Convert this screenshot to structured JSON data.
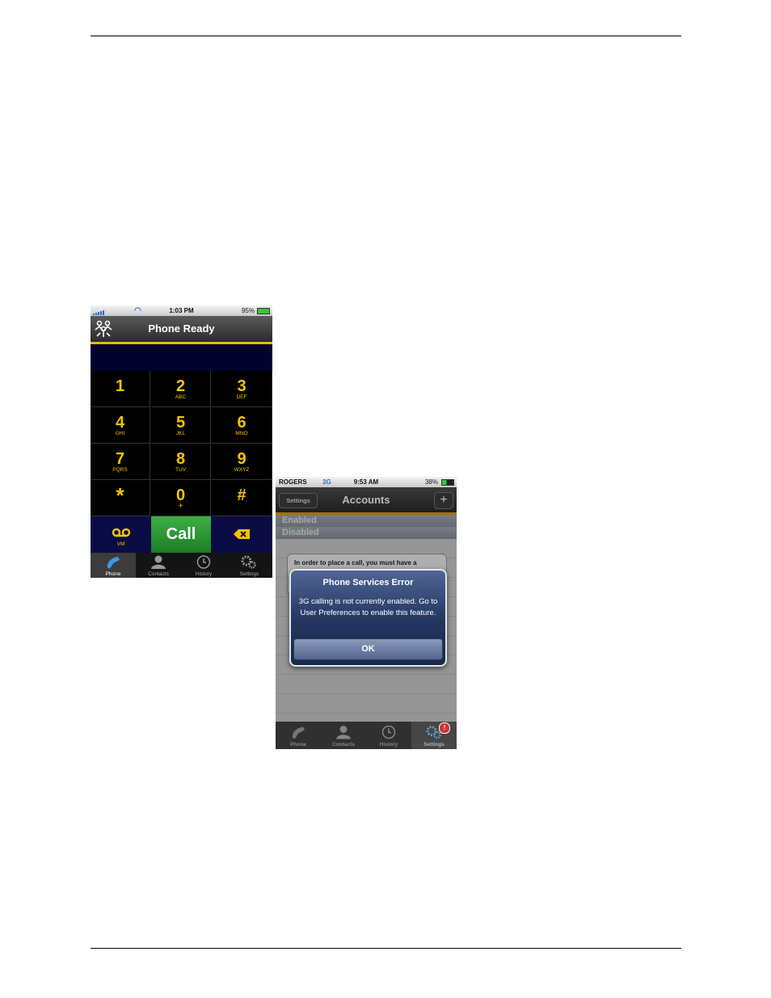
{
  "phone1": {
    "status": {
      "time": "1:03 PM",
      "battery": "95%"
    },
    "nav_title": "Phone Ready",
    "keys": [
      {
        "digit": "1",
        "letters": ""
      },
      {
        "digit": "2",
        "letters": "ABC"
      },
      {
        "digit": "3",
        "letters": "DEF"
      },
      {
        "digit": "4",
        "letters": "GHI"
      },
      {
        "digit": "5",
        "letters": "JKL"
      },
      {
        "digit": "6",
        "letters": "MNO"
      },
      {
        "digit": "7",
        "letters": "PQRS"
      },
      {
        "digit": "8",
        "letters": "TUV"
      },
      {
        "digit": "9",
        "letters": "WXYZ"
      },
      {
        "digit": "*",
        "letters": ""
      },
      {
        "digit": "0",
        "letters": "+"
      },
      {
        "digit": "#",
        "letters": ""
      }
    ],
    "voicemail_label": "VM",
    "call_label": "Call",
    "tabs": [
      "Phone",
      "Contacts",
      "History",
      "Settings"
    ],
    "active_tab": "Phone"
  },
  "phone2": {
    "status": {
      "carrier": "ROGERS",
      "network": "3G",
      "time": "9:53 AM",
      "battery": "38%"
    },
    "back_label": "Settings",
    "nav_title": "Accounts",
    "add_label": "+",
    "options": [
      "Enabled",
      "Disabled"
    ],
    "background_text": "In order to place a call, you must have a",
    "alert": {
      "title": "Phone Services Error",
      "message": "3G calling is not currently enabled. Go to User Preferences to enable this feature.",
      "ok_label": "OK"
    },
    "tabs": [
      "Phone",
      "Contacts",
      "History",
      "Settings"
    ],
    "active_tab": "Settings",
    "settings_badge": "!"
  }
}
